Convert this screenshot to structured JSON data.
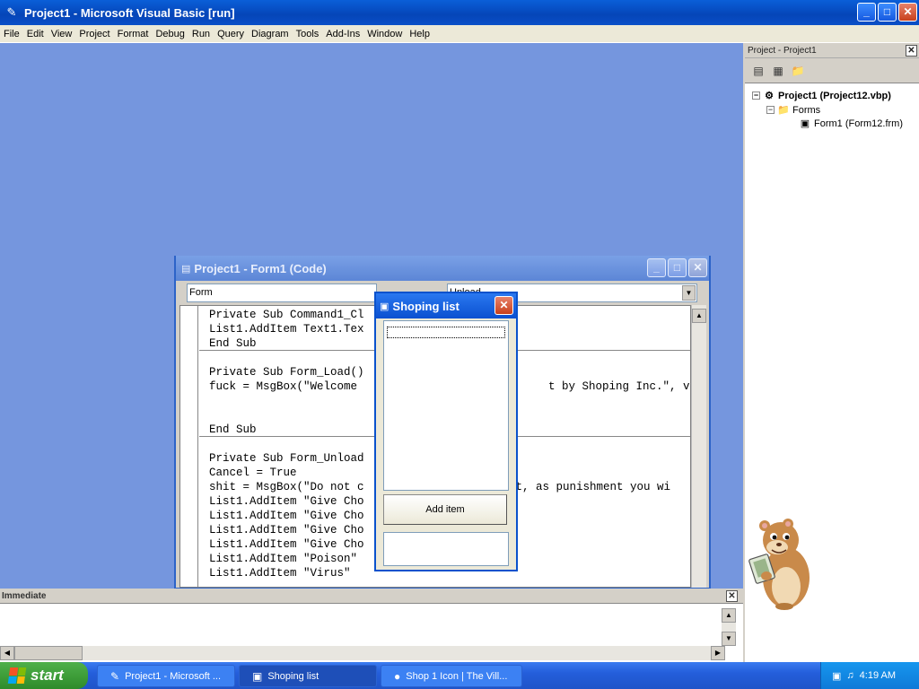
{
  "app": {
    "title": "Project1 - Microsoft Visual Basic [run]",
    "icon": "vb-app-icon"
  },
  "window_controls": {
    "minimize": "_",
    "maximize": "□",
    "close": "✕"
  },
  "menu": {
    "items": [
      "File",
      "Edit",
      "View",
      "Project",
      "Format",
      "Debug",
      "Run",
      "Query",
      "Diagram",
      "Tools",
      "Add-Ins",
      "Window",
      "Help"
    ]
  },
  "project_explorer": {
    "title": "Project - Project1",
    "close": "✕",
    "tree": {
      "project": "Project1 (Project12.vbp)",
      "folder": "Forms",
      "form": "Form1 (Form12.frm)"
    }
  },
  "code_window": {
    "title": "Project1 - Form1 (Code)",
    "object_combo": "Form",
    "proc_combo": "Unload",
    "lines": [
      "Private Sub Command1_Cl",
      "List1.AddItem Text1.Tex",
      "End Sub",
      "Private Sub Form_Load()",
      "fuck = MsgBox(\"Welcome",
      "End Sub",
      "Private Sub Form_Unload",
      "Cancel = True",
      "shit = MsgBox(\"Do not c",
      "List1.AddItem \"Give Cho",
      "List1.AddItem \"Give Cho",
      "List1.AddItem \"Give Cho",
      "List1.AddItem \"Give Cho",
      "List1.AddItem \"Poison\"",
      "List1.AddItem \"Virus\""
    ],
    "tail_load": "t by Shoping Inc.\", vbIn",
    "tail_unload": "st, as punishment you wi"
  },
  "shopping_form": {
    "title": "Shoping list",
    "close": "✕",
    "add_button": "Add item"
  },
  "immediate": {
    "title": "Immediate",
    "close": "✕"
  },
  "taskbar": {
    "start": "start",
    "tasks": [
      {
        "label": "Project1 - Microsoft ...",
        "icon": "vb-icon"
      },
      {
        "label": "Shoping list",
        "icon": "form-icon"
      },
      {
        "label": "Shop 1 Icon | The Vill...",
        "icon": "browser-icon"
      }
    ],
    "clock": "4:19 AM"
  },
  "colors": {
    "mdi_background": "#7596de",
    "title_active": "#0545b8",
    "title_inactive": "#5c86d6",
    "taskbar": "#245edb",
    "start_button": "#2e8b2a"
  }
}
